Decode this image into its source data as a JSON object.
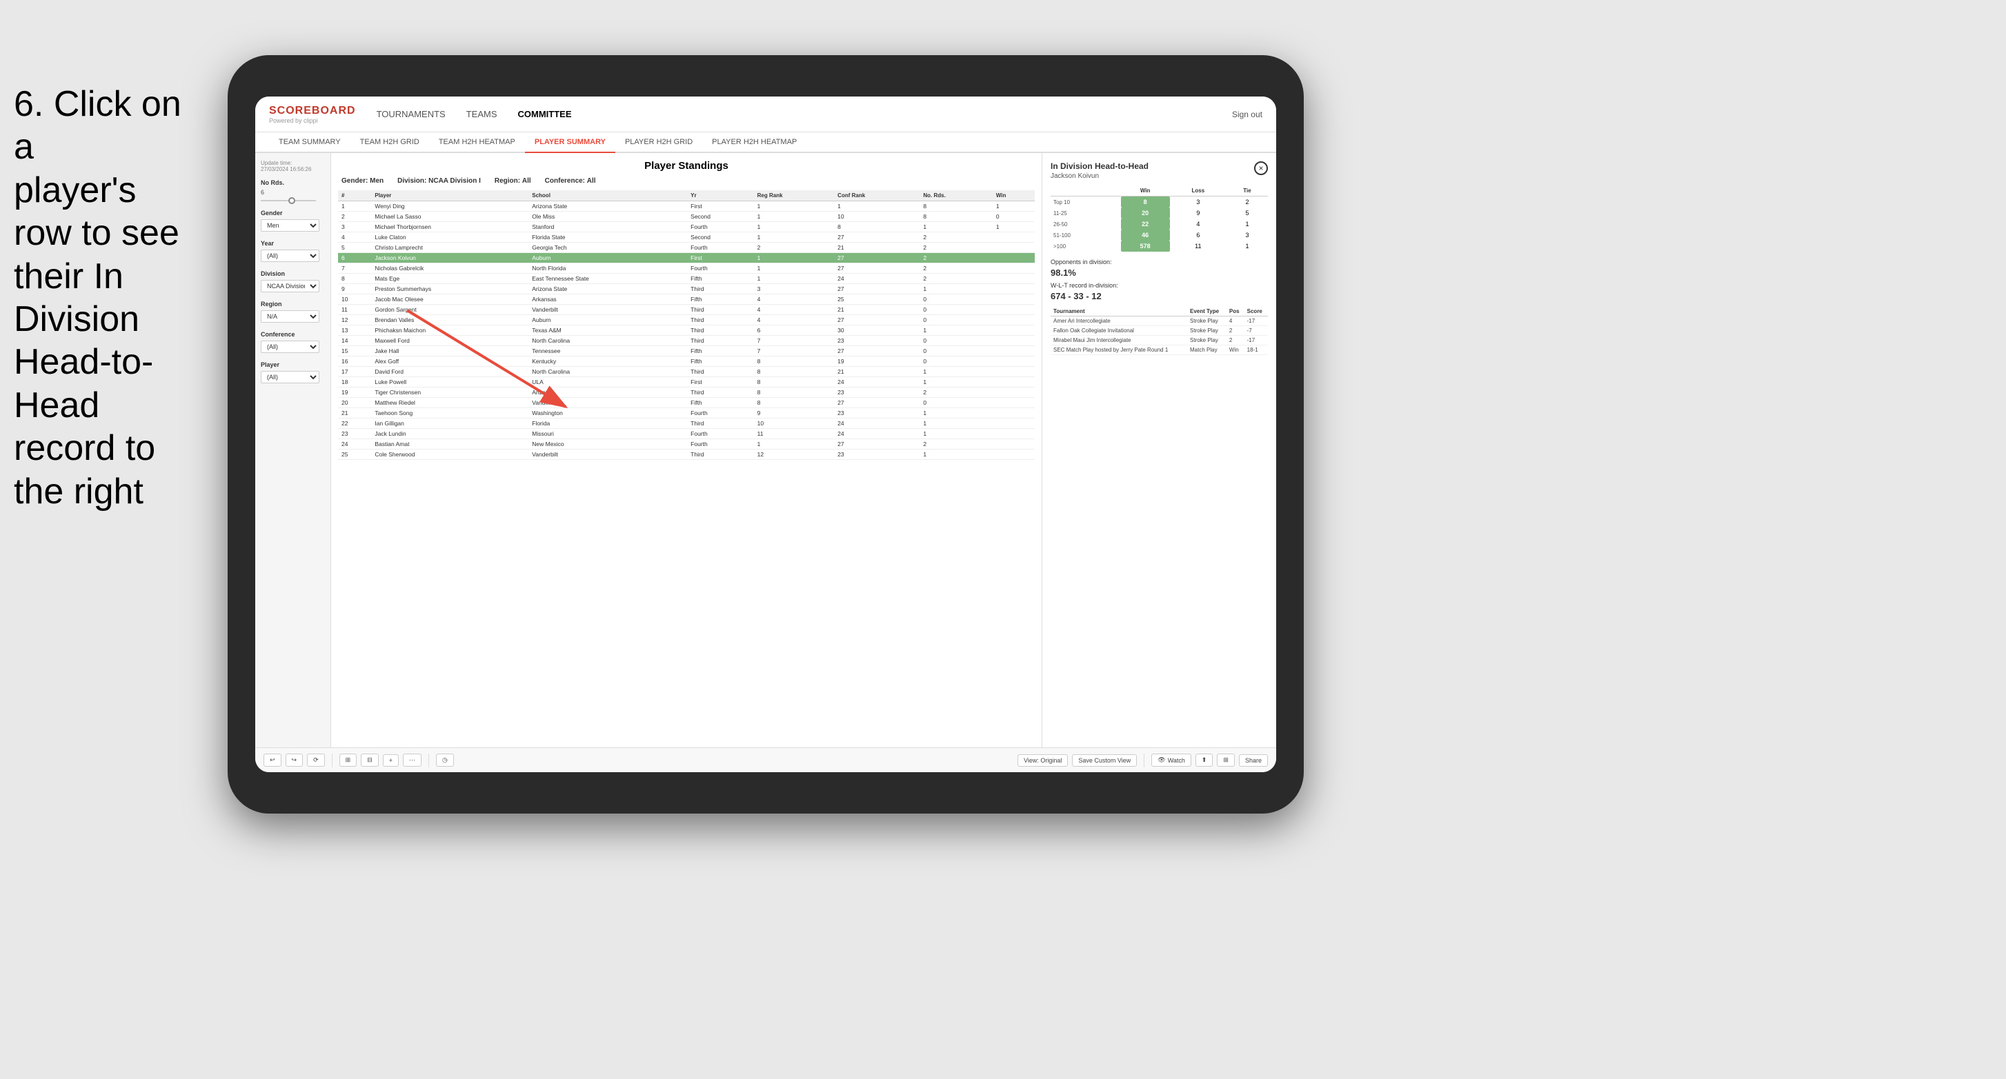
{
  "instruction": {
    "line1": "6. Click on a",
    "line2": "player's row to see",
    "line3": "their In Division",
    "line4": "Head-to-Head",
    "line5": "record to the right"
  },
  "header": {
    "logo": "SCOREBOARD",
    "logo_sub": "Powered by clippi",
    "nav": [
      "TOURNAMENTS",
      "TEAMS",
      "COMMITTEE"
    ],
    "sign_out": "Sign out"
  },
  "sub_nav": {
    "items": [
      "TEAM SUMMARY",
      "TEAM H2H GRID",
      "TEAM H2H HEATMAP",
      "PLAYER SUMMARY",
      "PLAYER H2H GRID",
      "PLAYER H2H HEATMAP"
    ],
    "active": "PLAYER SUMMARY"
  },
  "sidebar": {
    "update_label": "Update time:",
    "update_time": "27/03/2024 16:56:26",
    "no_rds_label": "No Rds.",
    "no_rds_value": "6",
    "slider_min": "0",
    "gender_label": "Gender",
    "gender_value": "Men",
    "year_label": "Year",
    "year_value": "(All)",
    "division_label": "Division",
    "division_value": "NCAA Division I",
    "region_label": "Region",
    "region_value": "N/A",
    "conference_label": "Conference",
    "conference_value": "(All)",
    "player_label": "Player",
    "player_value": "(All)"
  },
  "standings": {
    "title": "Player Standings",
    "gender_label": "Gender:",
    "gender_value": "Men",
    "division_label": "Division:",
    "division_value": "NCAA Division I",
    "region_label": "Region:",
    "region_value": "All",
    "conference_label": "Conference:",
    "conference_value": "All",
    "columns": [
      "#",
      "Player",
      "School",
      "Yr",
      "Reg Rank",
      "Conf Rank",
      "No. Rds.",
      "Win"
    ],
    "rows": [
      {
        "num": "1",
        "player": "Wenyi Ding",
        "school": "Arizona State",
        "yr": "First",
        "reg": "1",
        "conf": "1",
        "rds": "8",
        "win": "1"
      },
      {
        "num": "2",
        "player": "Michael La Sasso",
        "school": "Ole Miss",
        "yr": "Second",
        "reg": "1",
        "conf": "10",
        "rds": "8",
        "win": "0"
      },
      {
        "num": "3",
        "player": "Michael Thorbjornsen",
        "school": "Stanford",
        "yr": "Fourth",
        "reg": "1",
        "conf": "8",
        "rds": "1",
        "win": "1"
      },
      {
        "num": "4",
        "player": "Luke Claton",
        "school": "Florida State",
        "yr": "Second",
        "reg": "1",
        "conf": "27",
        "rds": "2",
        "win": ""
      },
      {
        "num": "5",
        "player": "Christo Lamprecht",
        "school": "Georgia Tech",
        "yr": "Fourth",
        "reg": "2",
        "conf": "21",
        "rds": "2",
        "win": ""
      },
      {
        "num": "6",
        "player": "Jackson Koivun",
        "school": "Auburn",
        "yr": "First",
        "reg": "1",
        "conf": "27",
        "rds": "2",
        "win": ""
      },
      {
        "num": "7",
        "player": "Nicholas Gabrelcik",
        "school": "North Florida",
        "yr": "Fourth",
        "reg": "1",
        "conf": "27",
        "rds": "2",
        "win": ""
      },
      {
        "num": "8",
        "player": "Mats Ege",
        "school": "East Tennessee State",
        "yr": "Fifth",
        "reg": "1",
        "conf": "24",
        "rds": "2",
        "win": ""
      },
      {
        "num": "9",
        "player": "Preston Summerhays",
        "school": "Arizona State",
        "yr": "Third",
        "reg": "3",
        "conf": "27",
        "rds": "1",
        "win": ""
      },
      {
        "num": "10",
        "player": "Jacob Mac Olesee",
        "school": "Arkansas",
        "yr": "Fifth",
        "reg": "4",
        "conf": "25",
        "rds": "0",
        "win": ""
      },
      {
        "num": "11",
        "player": "Gordon Sargent",
        "school": "Vanderbilt",
        "yr": "Third",
        "reg": "4",
        "conf": "21",
        "rds": "0",
        "win": ""
      },
      {
        "num": "12",
        "player": "Brendan Valles",
        "school": "Auburn",
        "yr": "Third",
        "reg": "4",
        "conf": "27",
        "rds": "0",
        "win": ""
      },
      {
        "num": "13",
        "player": "Phichaksn Maichon",
        "school": "Texas A&M",
        "yr": "Third",
        "reg": "6",
        "conf": "30",
        "rds": "1",
        "win": ""
      },
      {
        "num": "14",
        "player": "Maxwell Ford",
        "school": "North Carolina",
        "yr": "Third",
        "reg": "7",
        "conf": "23",
        "rds": "0",
        "win": ""
      },
      {
        "num": "15",
        "player": "Jake Hall",
        "school": "Tennessee",
        "yr": "Fifth",
        "reg": "7",
        "conf": "27",
        "rds": "0",
        "win": ""
      },
      {
        "num": "16",
        "player": "Alex Goff",
        "school": "Kentucky",
        "yr": "Fifth",
        "reg": "8",
        "conf": "19",
        "rds": "0",
        "win": ""
      },
      {
        "num": "17",
        "player": "David Ford",
        "school": "North Carolina",
        "yr": "Third",
        "reg": "8",
        "conf": "21",
        "rds": "1",
        "win": ""
      },
      {
        "num": "18",
        "player": "Luke Powell",
        "school": "ULA",
        "yr": "First",
        "reg": "8",
        "conf": "24",
        "rds": "1",
        "win": ""
      },
      {
        "num": "19",
        "player": "Tiger Christensen",
        "school": "Arizona",
        "yr": "Third",
        "reg": "8",
        "conf": "23",
        "rds": "2",
        "win": ""
      },
      {
        "num": "20",
        "player": "Matthew Riedel",
        "school": "Vanderbilt",
        "yr": "Fifth",
        "reg": "8",
        "conf": "27",
        "rds": "0",
        "win": ""
      },
      {
        "num": "21",
        "player": "Taehoon Song",
        "school": "Washington",
        "yr": "Fourth",
        "reg": "9",
        "conf": "23",
        "rds": "1",
        "win": ""
      },
      {
        "num": "22",
        "player": "Ian Gilligan",
        "school": "Florida",
        "yr": "Third",
        "reg": "10",
        "conf": "24",
        "rds": "1",
        "win": ""
      },
      {
        "num": "23",
        "player": "Jack Lundin",
        "school": "Missouri",
        "yr": "Fourth",
        "reg": "11",
        "conf": "24",
        "rds": "1",
        "win": ""
      },
      {
        "num": "24",
        "player": "Bastian Amat",
        "school": "New Mexico",
        "yr": "Fourth",
        "reg": "1",
        "conf": "27",
        "rds": "2",
        "win": ""
      },
      {
        "num": "25",
        "player": "Cole Sherwood",
        "school": "Vanderbilt",
        "yr": "Third",
        "reg": "12",
        "conf": "23",
        "rds": "1",
        "win": ""
      }
    ]
  },
  "h2h_panel": {
    "title": "In Division Head-to-Head",
    "player_name": "Jackson Koivun",
    "close_label": "×",
    "table_headers": [
      "",
      "Win",
      "Loss",
      "Tie"
    ],
    "table_rows": [
      {
        "rank": "Top 10",
        "win": "8",
        "loss": "3",
        "tie": "2"
      },
      {
        "rank": "11-25",
        "win": "20",
        "loss": "9",
        "tie": "5"
      },
      {
        "rank": "26-50",
        "win": "22",
        "loss": "4",
        "tie": "1"
      },
      {
        "rank": "51-100",
        "win": "46",
        "loss": "6",
        "tie": "3"
      },
      {
        "rank": ">100",
        "win": "578",
        "loss": "11",
        "tie": "1"
      }
    ],
    "opponents_label": "Opponents in division:",
    "opponents_value": "98.1%",
    "record_label": "W-L-T record in-division:",
    "record_value": "674 - 33 - 12",
    "tournament_headers": [
      "Tournament",
      "Event Type",
      "Pos",
      "Score"
    ],
    "tournament_rows": [
      {
        "tournament": "Amer Ari Intercollegiate",
        "type": "Stroke Play",
        "pos": "4",
        "score": "-17"
      },
      {
        "tournament": "Fallon Oak Collegiate Invitational",
        "type": "Stroke Play",
        "pos": "2",
        "score": "-7"
      },
      {
        "tournament": "Mirabel Maui Jim Intercollegiate",
        "type": "Stroke Play",
        "pos": "2",
        "score": "-17"
      },
      {
        "tournament": "SEC Match Play hosted by Jerry Pate Round 1",
        "type": "Match Play",
        "pos": "Win",
        "score": "18-1"
      }
    ]
  },
  "toolbar": {
    "view_original": "View: Original",
    "save_custom": "Save Custom View",
    "watch": "Watch",
    "share": "Share"
  }
}
